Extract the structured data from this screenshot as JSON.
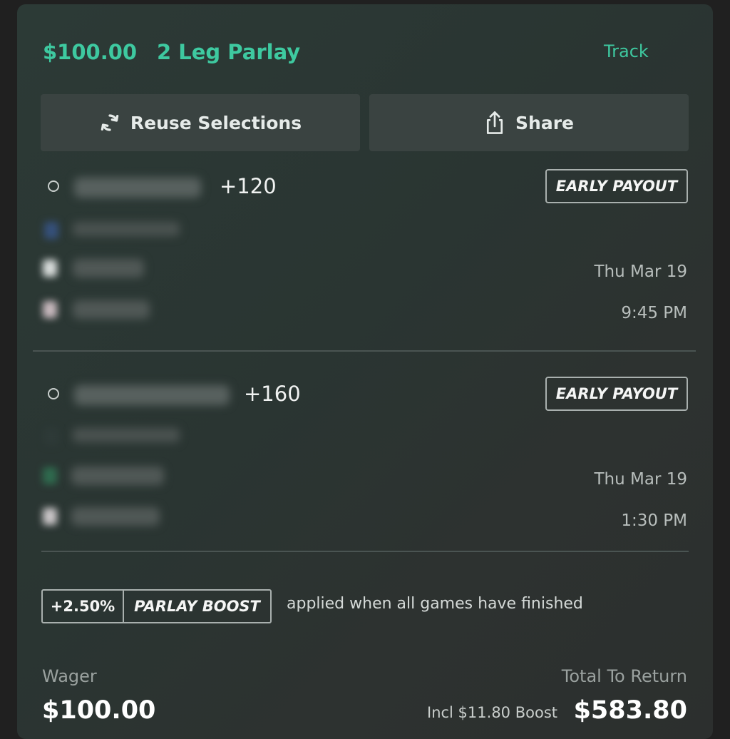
{
  "header": {
    "amount": "$100.00",
    "title": "2 Leg Parlay",
    "track_label": "Track"
  },
  "actions": {
    "reuse_label": "Reuse Selections",
    "share_label": "Share",
    "reuse_icon": "refresh-icon",
    "share_icon": "share-icon"
  },
  "legs": [
    {
      "odds": "+120",
      "badge": "EARLY PAYOUT",
      "date": "Thu Mar 19",
      "time": "9:45 PM"
    },
    {
      "odds": "+160",
      "badge": "EARLY PAYOUT",
      "date": "Thu Mar 19",
      "time": "1:30 PM"
    }
  ],
  "boost": {
    "percent": "+2.50%",
    "label": "PARLAY BOOST",
    "note": "applied when all games have finished"
  },
  "summary": {
    "wager_label": "Wager",
    "wager_value": "$100.00",
    "return_label": "Total To Return",
    "boost_incl": "Incl $11.80 Boost",
    "return_value": "$583.80"
  },
  "colors": {
    "accent": "#3ec9a0",
    "card_bg": "#2b3532",
    "button_bg": "#3a4341"
  }
}
